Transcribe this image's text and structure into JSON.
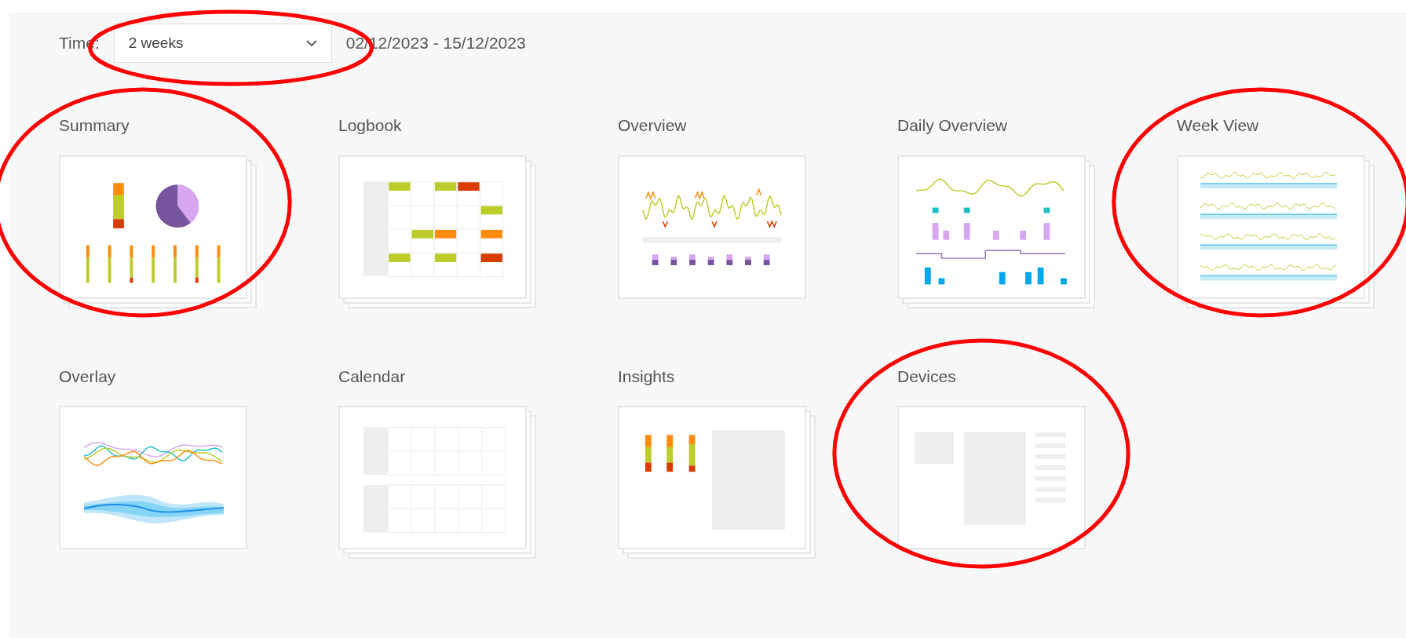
{
  "time_filter": {
    "label": "Time:",
    "value": "2 weeks",
    "range": "02/12/2023 - 15/12/2023",
    "highlighted": true
  },
  "reports": [
    {
      "title": "Summary",
      "kind": "summary",
      "stacked": true,
      "highlighted": true
    },
    {
      "title": "Logbook",
      "kind": "logbook",
      "stacked": true,
      "highlighted": false
    },
    {
      "title": "Overview",
      "kind": "overview",
      "stacked": false,
      "highlighted": false
    },
    {
      "title": "Daily Overview",
      "kind": "daily",
      "stacked": true,
      "highlighted": false
    },
    {
      "title": "Week View",
      "kind": "week",
      "stacked": true,
      "highlighted": true
    },
    {
      "title": "Overlay",
      "kind": "overlay",
      "stacked": false,
      "highlighted": false
    },
    {
      "title": "Calendar",
      "kind": "calendar",
      "stacked": true,
      "highlighted": false
    },
    {
      "title": "Insights",
      "kind": "insights",
      "stacked": true,
      "highlighted": false
    },
    {
      "title": "Devices",
      "kind": "devices",
      "stacked": false,
      "highlighted": true
    }
  ]
}
